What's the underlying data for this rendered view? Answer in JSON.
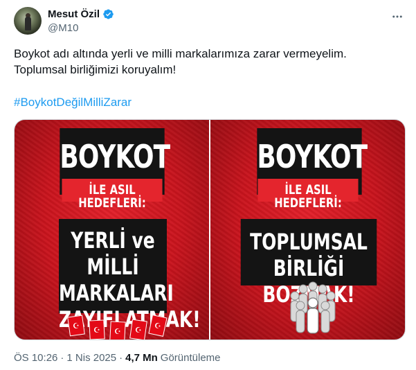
{
  "author": {
    "display_name": "Mesut Özil",
    "handle": "@M10",
    "verified": true,
    "verified_color": "#1d9bf0"
  },
  "tweet": {
    "lines": [
      "Boykot adı altında yerli ve milli markalarımıza zarar vermeyelim.",
      "Toplumsal birliğimizi koruyalım!"
    ],
    "hashtag": "#BoykotDeğilMilliZarar"
  },
  "media": {
    "left": {
      "title": "BOYKOT",
      "subtitle": "İLE ASIL HEDEFLERİ:",
      "main_lines": [
        "YERLİ ve MİLLİ",
        "MARKALARI",
        "ZAYIFLATMAK!"
      ]
    },
    "right": {
      "title": "BOYKOT",
      "subtitle": "İLE ASIL HEDEFLERİ:",
      "main_lines": [
        "TOPLUMSAL BİRLİĞİ",
        "BOZMAK!"
      ]
    }
  },
  "footer": {
    "time": "ÖS 10:26",
    "separator": "·",
    "date": "1 Nis 2025",
    "views_count": "4,7 Mn",
    "views_label": "Görüntüleme"
  },
  "icons": {
    "more": "more-icon",
    "verified": "verified-badge-icon"
  }
}
